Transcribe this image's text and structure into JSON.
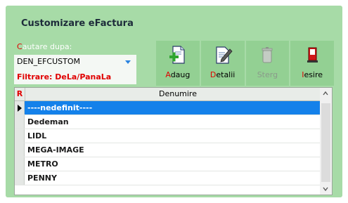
{
  "window": {
    "title": "Customizare eFactura"
  },
  "search": {
    "label_hot": "C",
    "label_rest": "autare dupa:",
    "value": "DEN_EFCUSTOM",
    "filter_text": "Filtrare: DeLa/PanaLa"
  },
  "toolbar": {
    "buttons": [
      {
        "hot": "A",
        "rest": "daug",
        "icon": "add-document-icon",
        "enabled": true
      },
      {
        "hot": "D",
        "rest": "etalii",
        "icon": "edit-document-icon",
        "enabled": true
      },
      {
        "hot": "",
        "rest": "Sterg",
        "icon": "trash-icon",
        "enabled": false
      },
      {
        "hot": "I",
        "rest": "esire",
        "icon": "exit-door-icon",
        "enabled": true
      }
    ]
  },
  "grid": {
    "corner_label": "R",
    "column_header": "Denumire",
    "rows": [
      "----nedefinit----",
      "Dedeman",
      "LIDL",
      "MEGA-IMAGE",
      "METRO",
      "PENNY"
    ],
    "selected_index": 0
  },
  "colors": {
    "panel": "#a7dba7",
    "selection": "#1481ea",
    "hotkey": "#e00000"
  }
}
